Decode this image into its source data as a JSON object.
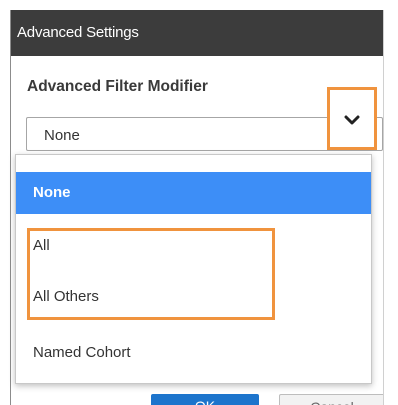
{
  "dialog": {
    "title": "Advanced Settings",
    "field_label": "Advanced Filter Modifier",
    "select": {
      "value": "None"
    },
    "options": [
      {
        "label": "None",
        "selected": true
      },
      {
        "label": "All",
        "selected": false
      },
      {
        "label": "All Others",
        "selected": false
      },
      {
        "label": "Named Cohort",
        "selected": false
      }
    ],
    "buttons": {
      "ok": "OK",
      "cancel": "Cancel"
    }
  },
  "colors": {
    "title_bar": "#3c3c3c",
    "selected_option": "#3d8ef7",
    "highlight": "#f0933e",
    "ok_button": "#1c74cc"
  },
  "icons": {
    "dropdown": "chevron-down-icon"
  }
}
